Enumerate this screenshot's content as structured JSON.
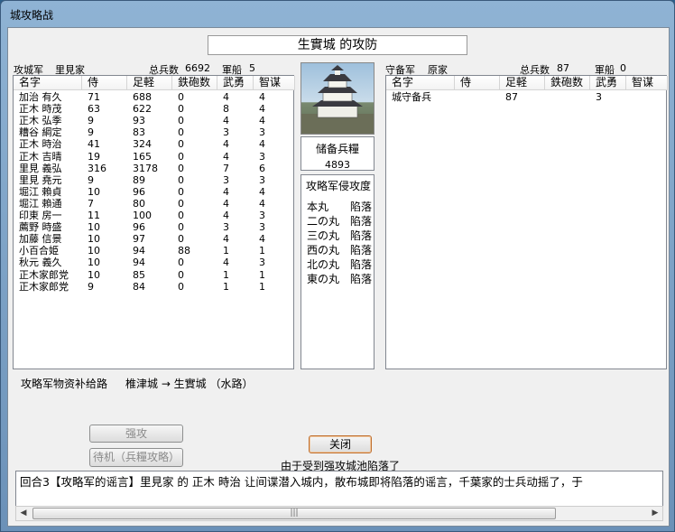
{
  "window": {
    "title": "城攻略战"
  },
  "caption": "生實城 的攻防",
  "attacker": {
    "label": "攻城军",
    "clan": "里見家",
    "total_label": "总兵数",
    "total": "6692",
    "ships_label": "軍船",
    "ships": "5"
  },
  "defender": {
    "label": "守备军",
    "clan": "原家",
    "total_label": "总兵数",
    "total": "87",
    "ships_label": "軍船",
    "ships": "0"
  },
  "columns": [
    "名字",
    "侍",
    "足軽",
    "鉄砲数",
    "武勇",
    "智谋"
  ],
  "attacker_rows": [
    [
      "加治 有久",
      "71",
      "688",
      "0",
      "4",
      "4"
    ],
    [
      "正木 時茂",
      "63",
      "622",
      "0",
      "8",
      "4"
    ],
    [
      "正木 弘季",
      "9",
      "93",
      "0",
      "4",
      "4"
    ],
    [
      "糟谷 綱定",
      "9",
      "83",
      "0",
      "3",
      "3"
    ],
    [
      "正木 時治",
      "41",
      "324",
      "0",
      "4",
      "4"
    ],
    [
      "正木 吉晴",
      "19",
      "165",
      "0",
      "4",
      "3"
    ],
    [
      "里見 義弘",
      "316",
      "3178",
      "0",
      "7",
      "6"
    ],
    [
      "里見 堯元",
      "9",
      "89",
      "0",
      "3",
      "3"
    ],
    [
      "堀江 賴貞",
      "10",
      "96",
      "0",
      "4",
      "4"
    ],
    [
      "堀江 賴通",
      "7",
      "80",
      "0",
      "4",
      "4"
    ],
    [
      "印東 房一",
      "11",
      "100",
      "0",
      "4",
      "3"
    ],
    [
      "薦野 時盛",
      "10",
      "96",
      "0",
      "3",
      "3"
    ],
    [
      "加藤 信景",
      "10",
      "97",
      "0",
      "4",
      "4"
    ],
    [
      "小百合姫",
      "10",
      "94",
      "88",
      "1",
      "1"
    ],
    [
      "秋元 義久",
      "10",
      "94",
      "0",
      "4",
      "3"
    ],
    [
      "正木家郎党",
      "10",
      "85",
      "0",
      "1",
      "1"
    ],
    [
      "正木家郎党",
      "9",
      "84",
      "0",
      "1",
      "1"
    ]
  ],
  "defender_rows": [
    [
      "城守备兵",
      "",
      "87",
      "",
      "3",
      ""
    ]
  ],
  "storage": {
    "label": "储备兵糧",
    "value": "4893"
  },
  "progress": {
    "title": "攻略军侵攻度",
    "items": [
      [
        "本丸",
        "陷落"
      ],
      [
        "二の丸",
        "陷落"
      ],
      [
        "三の丸",
        "陷落"
      ],
      [
        "西の丸",
        "陷落"
      ],
      [
        "北の丸",
        "陷落"
      ],
      [
        "東の丸",
        "陷落"
      ]
    ]
  },
  "supply": {
    "label": "攻略军物资补给路",
    "route": "椎津城 → 生實城 （水路）"
  },
  "buttons": {
    "attack": "强攻",
    "wait": "待机（兵糧攻略）",
    "close": "关闭"
  },
  "status": "由于受到强攻城池陷落了",
  "log": "回合3【攻略军的谣言】里見家 的 正木 時治 让间谍潜入城内，散布城即将陷落的谣言，千葉家的士兵动摇了，于"
}
